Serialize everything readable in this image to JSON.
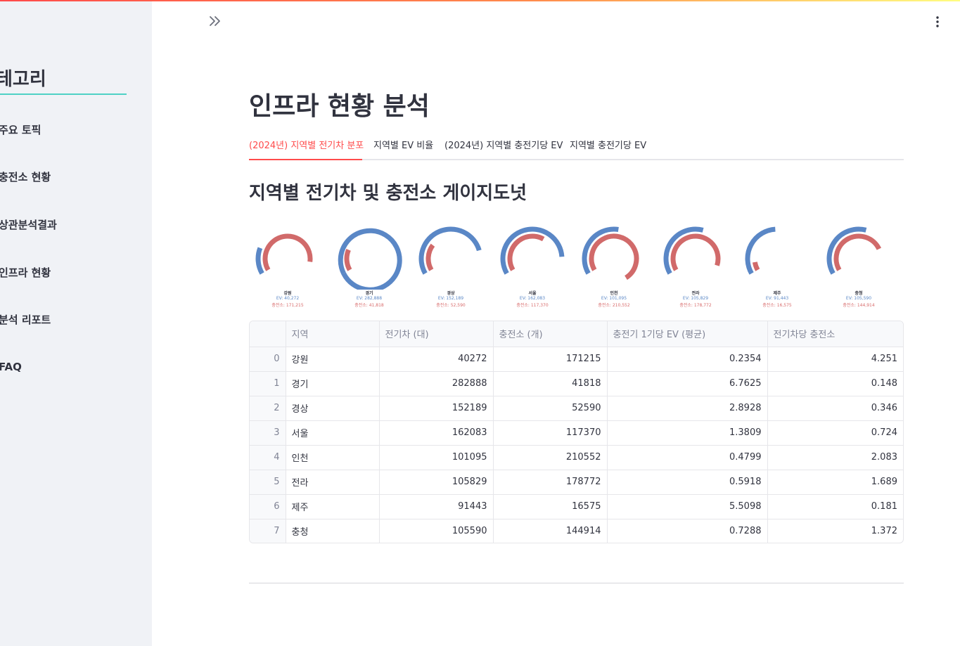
{
  "sidebar": {
    "title": "테고리",
    "items": [
      {
        "label": "주요 토픽"
      },
      {
        "label": "충전소 현황"
      },
      {
        "label": "상관분석결과"
      },
      {
        "label": "인프라 현황"
      },
      {
        "label": "분석 리포트"
      },
      {
        "label": "FAQ"
      }
    ]
  },
  "header": {
    "collapse_icon": "double-chevron-right-icon",
    "menu_icon": "vertical-ellipsis-icon"
  },
  "main": {
    "title": "인프라 현황 분석",
    "tabs": [
      {
        "label": "(2024년) 지역별 전기차 분포",
        "active": true
      },
      {
        "label": "지역별 EV 비율",
        "active": false
      },
      {
        "label": "(2024년) 지역별 충전기당 EV",
        "active": false
      },
      {
        "label": "지역별 충전기당 EV",
        "active": false
      }
    ],
    "section_title": "지역별 전기차 및 충전소 게이지도넛"
  },
  "colors": {
    "ev": "#5a87c6",
    "charger": "#d16a6a",
    "accent": "#ff4b4b"
  },
  "chart_data": {
    "type": "gauge-donut",
    "categories": [
      "강원",
      "경기",
      "경상",
      "서울",
      "인천",
      "전라",
      "제주",
      "충청"
    ],
    "series": [
      {
        "name": "EV",
        "values": [
          40272,
          282888,
          152189,
          162083,
          101095,
          105829,
          91443,
          105590
        ]
      },
      {
        "name": "충전소",
        "values": [
          171215,
          41818,
          52590,
          117370,
          210552,
          178772,
          16575,
          144914
        ]
      }
    ],
    "labels": [
      {
        "name": "강원",
        "ev": "EV: 40,272",
        "ch": "충전소: 171,215"
      },
      {
        "name": "경기",
        "ev": "EV: 282,888",
        "ch": "충전소: 41,818"
      },
      {
        "name": "경상",
        "ev": "EV: 152,189",
        "ch": "충전소: 52,590"
      },
      {
        "name": "서울",
        "ev": "EV: 162,083",
        "ch": "충전소: 117,370"
      },
      {
        "name": "인천",
        "ev": "EV: 101,095",
        "ch": "충전소: 210,552"
      },
      {
        "name": "전라",
        "ev": "EV: 105,829",
        "ch": "충전소: 178,772"
      },
      {
        "name": "제주",
        "ev": "EV: 91,443",
        "ch": "충전소: 16,575"
      },
      {
        "name": "충청",
        "ev": "EV: 105,590",
        "ch": "충전소: 144,914"
      }
    ]
  },
  "table": {
    "headers": [
      "",
      "지역",
      "전기차 (대)",
      "충전소 (개)",
      "충전기 1기당 EV (평균)",
      "전기차당 충전소"
    ],
    "rows": [
      [
        "0",
        "강원",
        "40272",
        "171215",
        "0.2354",
        "4.251"
      ],
      [
        "1",
        "경기",
        "282888",
        "41818",
        "6.7625",
        "0.148"
      ],
      [
        "2",
        "경상",
        "152189",
        "52590",
        "2.8928",
        "0.346"
      ],
      [
        "3",
        "서울",
        "162083",
        "117370",
        "1.3809",
        "0.724"
      ],
      [
        "4",
        "인천",
        "101095",
        "210552",
        "0.4799",
        "2.083"
      ],
      [
        "5",
        "전라",
        "105829",
        "178772",
        "0.5918",
        "1.689"
      ],
      [
        "6",
        "제주",
        "91443",
        "16575",
        "5.5098",
        "0.181"
      ],
      [
        "7",
        "충청",
        "105590",
        "144914",
        "0.7288",
        "1.372"
      ]
    ]
  }
}
